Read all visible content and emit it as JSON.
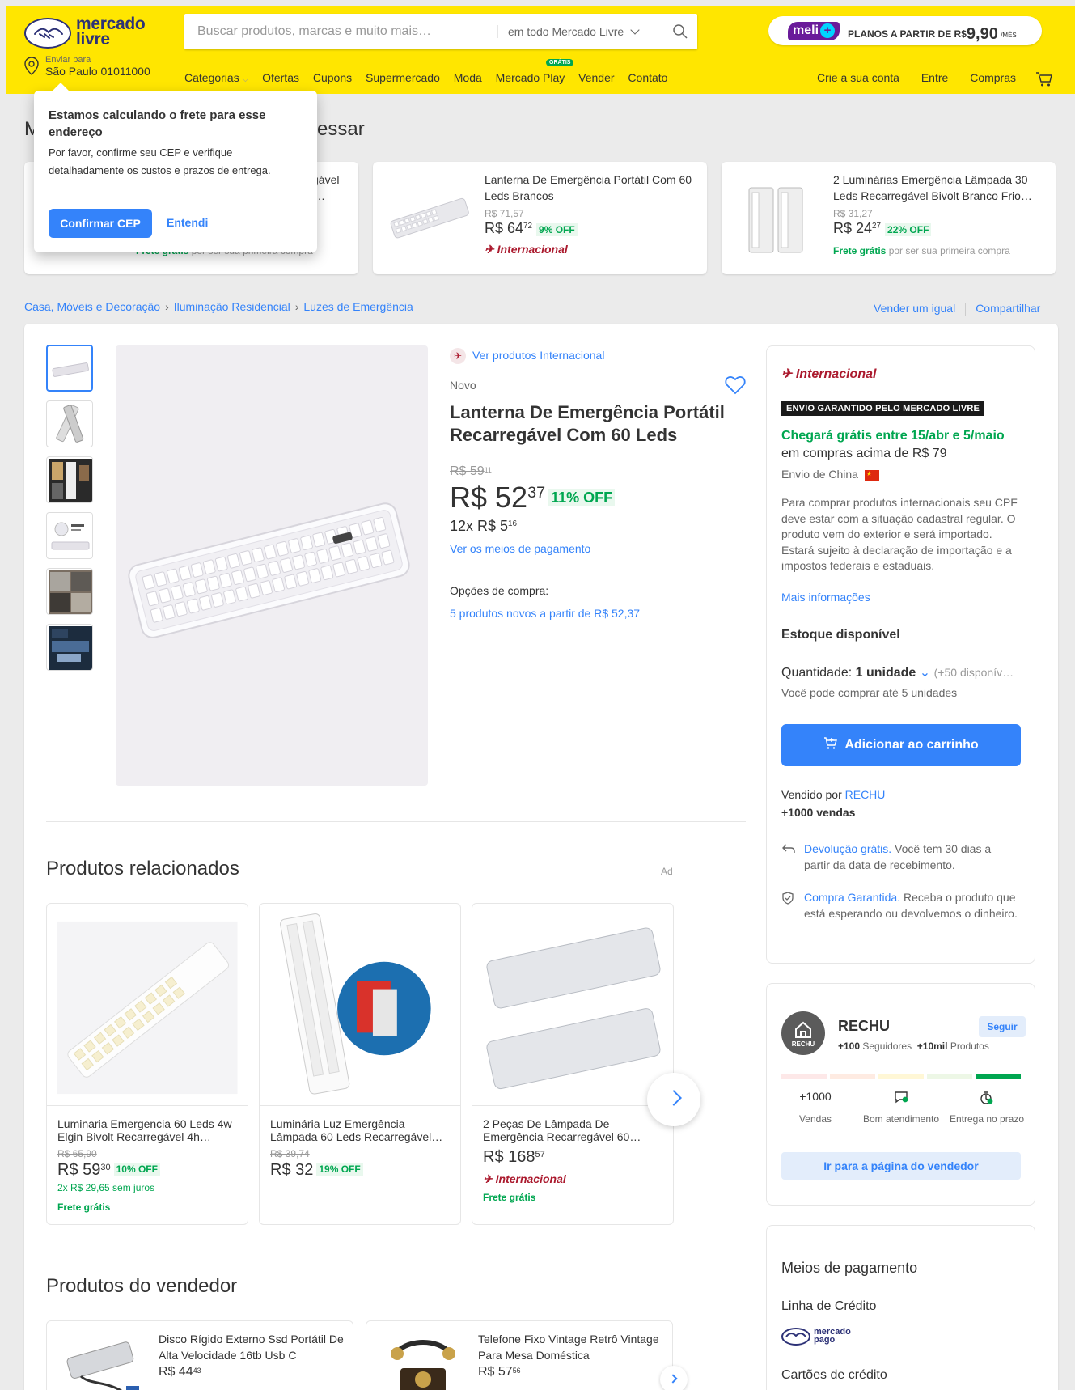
{
  "header": {
    "logo_line1": "mercado",
    "logo_line2": "livre",
    "search_placeholder": "Buscar produtos, marcas e muito mais…",
    "search_scope": "em todo Mercado Livre",
    "meli_badge": "meli",
    "meli_plus": "+",
    "meli_text": "PLANOS A PARTIR DE R$",
    "meli_price": "9,90",
    "meli_period": "/MÊS",
    "location_label": "Enviar para",
    "location_value": "São Paulo 01011000",
    "nav": [
      "Categorias",
      "Ofertas",
      "Cupons",
      "Supermercado",
      "Moda",
      "Mercado Play",
      "Vender",
      "Contato"
    ],
    "gratis_badge": "GRÁTIS",
    "nav_right": [
      "Crie a sua conta",
      "Entre",
      "Compras"
    ]
  },
  "popup": {
    "title": "Estamos calculando o frete para esse endereço",
    "body": "Por favor, confirme seu CEP e verifique detalhadamente os custos e prazos de entrega.",
    "confirm": "Confirmar CEP",
    "dismiss": "Entendi"
  },
  "history": {
    "title_left": "M",
    "title_right": "essar",
    "cards": [
      {
        "name_partial_1": "gável",
        "name_partial_2": "…",
        "free": "Frete grátis",
        "free_note": "por ser sua primeira compra"
      },
      {
        "name": "Lanterna De Emergência Portátil Com 60 Leds Brancos",
        "old_price": "R$ 71,57",
        "price_int": "R$ 64",
        "price_cents": "72",
        "off": "9% OFF",
        "intl": "Internacional"
      },
      {
        "name": "2 Luminárias Emergência Lâmpada 30 Leds Recarregável Bivolt Branco Frio…",
        "old_price": "R$ 31,27",
        "price_int": "R$ 24",
        "price_cents": "27",
        "off": "22% OFF",
        "free": "Frete grátis",
        "free_note": "por ser sua primeira compra"
      }
    ]
  },
  "breadcrumb": [
    "Casa, Móveis e Decoração",
    "Iluminação Residencial",
    "Luzes de Emergência"
  ],
  "share": {
    "sell": "Vender um igual",
    "share": "Compartilhar"
  },
  "product": {
    "intl_link": "Ver produtos Internacional",
    "condition": "Novo",
    "title": "Lanterna De Emergência Portátil Recarregável Com 60 Leds",
    "old_price": "R$ 59",
    "old_cents": "11",
    "price_int": "R$ 52",
    "price_cents": "37",
    "off": "11% OFF",
    "installments": "12x R$ 5",
    "installments_cents": "16",
    "payment_link": "Ver os meios de pagamento",
    "options_label": "Opções de compra:",
    "options_link": "5 produtos novos a partir de R$ 52,37"
  },
  "buybox": {
    "intl": "Internacional",
    "envio": "ENVIO GARANTIDO PELO MERCADO LIVRE",
    "chegara": "Chegará grátis entre 15/abr e 5/maio",
    "compras": "em compras acima de R$ 79",
    "china": "Envio de China",
    "aviso": "Para comprar produtos internacionais seu CPF deve estar com a situação cadastral regular. O produto vem do exterior e será importado. Estará sujeito à declaração de importação e a impostos federais e estaduais.",
    "mais": "Mais informações",
    "estoque": "Estoque disponível",
    "qtd_label": "Quantidade:",
    "qtd_value": "1 unidade",
    "qtd_disp": "(+50 disponív…",
    "ate": "Você pode comprar até 5 unidades",
    "add": "Adicionar ao carrinho",
    "vendido_por": "Vendido por",
    "seller": "RECHU",
    "vendas": "+1000 vendas",
    "devolucao_link": "Devolução grátis.",
    "devolucao_text": "Você tem 30 dias a partir da data de recebimento.",
    "garantia_link": "Compra Garantida.",
    "garantia_text": "Receba o produto que está esperando ou devolvemos o dinheiro."
  },
  "seller": {
    "avatar_text": "RECHU",
    "name": "RECHU",
    "follow": "Seguir",
    "followers_n": "+100",
    "followers_l": "Seguidores",
    "products_n": "+10mil",
    "products_l": "Produtos",
    "m1_value": "+1000",
    "m1_label": "Vendas",
    "m2_label": "Bom atendimento",
    "m3_label": "Entrega no prazo",
    "go": "Ir para a página do vendedor"
  },
  "payment": {
    "title": "Meios de pagamento",
    "credit": "Linha de Crédito",
    "mp_line1": "mercado",
    "mp_line2": "pago",
    "cards": "Cartões de crédito"
  },
  "related": {
    "title": "Produtos relacionados",
    "ad": "Ad",
    "items": [
      {
        "name": "Luminaria Emergencia 60 Leds 4w Elgin Bivolt Recarregável 4h…",
        "old": "R$ 65,90",
        "price": "R$ 59",
        "cents": "30",
        "off": "10% OFF",
        "inst": "2x R$ 29,65 sem juros",
        "free": "Frete grátis"
      },
      {
        "name": "Luminária Luz Emergência Lâmpada 60 Leds Recarregável…",
        "old": "R$ 39,74",
        "price": "R$ 32",
        "cents": "",
        "off": "19% OFF"
      },
      {
        "name": "2 Peças De Lâmpada De Emergência Recarregável 60…",
        "price": "R$ 168",
        "cents": "57",
        "intl": "Internacional",
        "free": "Frete grátis"
      }
    ]
  },
  "seller_products": {
    "title": "Produtos do vendedor",
    "items": [
      {
        "name": "Disco Rígido Externo Ssd Portátil De Alta Velocidade 16tb Usb C",
        "price": "R$ 44",
        "cents": "43"
      },
      {
        "name": "Telefone Fixo Vintage Retrô Vintage Para Mesa Doméstica",
        "price": "R$ 57",
        "cents": "56"
      }
    ]
  },
  "colors": {
    "brand_yellow": "#ffe600",
    "accent_blue": "#3483fa",
    "green": "#00a650",
    "intl_red": "#ab1a2e"
  }
}
